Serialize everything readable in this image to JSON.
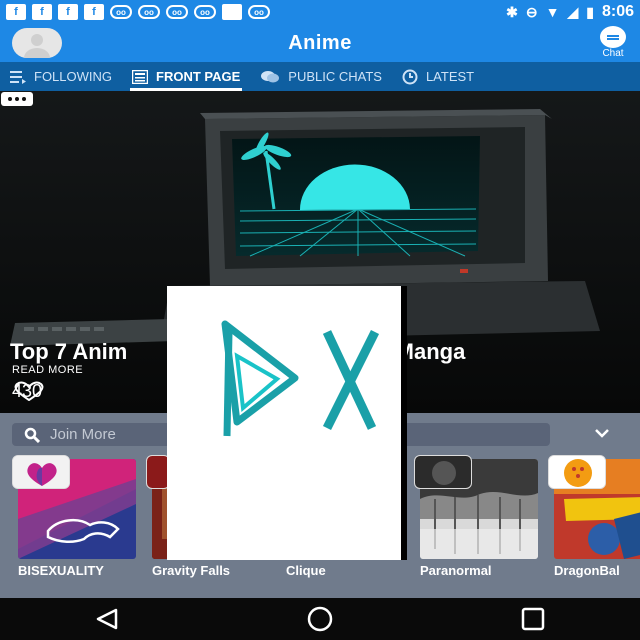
{
  "status_bar": {
    "icons": [
      "facebook-icon",
      "facebook-icon",
      "facebook-icon",
      "facebook-icon",
      "voicemail-icon",
      "voicemail-icon",
      "voicemail-icon",
      "voicemail-icon",
      "blank-square-icon",
      "voicemail-icon",
      "bluetooth-icon",
      "do-not-disturb-icon",
      "wifi-icon",
      "no-signal-icon",
      "battery-icon"
    ],
    "time": "8:06"
  },
  "app_bar": {
    "title": "Anime",
    "chat_label": "Chat"
  },
  "tabs": [
    {
      "label": "FOLLOWING",
      "icon": "list-icon",
      "active": false
    },
    {
      "label": "FRONT PAGE",
      "icon": "front-page-icon",
      "active": true
    },
    {
      "label": "PUBLIC CHATS",
      "icon": "chat-bubbles-icon",
      "active": false
    },
    {
      "label": "LATEST",
      "icon": "clock-icon",
      "active": false
    }
  ],
  "featured": {
    "title": "Top 7 Anim",
    "title_tail": "k Manga",
    "read_more": "READ MORE",
    "likes": "430"
  },
  "search": {
    "placeholder": "Join More"
  },
  "communities": [
    {
      "label": "BISEXUALITY"
    },
    {
      "label": "Gravity Falls"
    },
    {
      "label": "Clique"
    },
    {
      "label": "Paranormal"
    },
    {
      "label": "DragonBal"
    }
  ],
  "overlay": {
    "icons": [
      "play-icon",
      "close-icon"
    ]
  },
  "colors": {
    "primary": "#1e88e5",
    "tab_bar": "#0f5fa1",
    "panel": "#707b8c"
  }
}
